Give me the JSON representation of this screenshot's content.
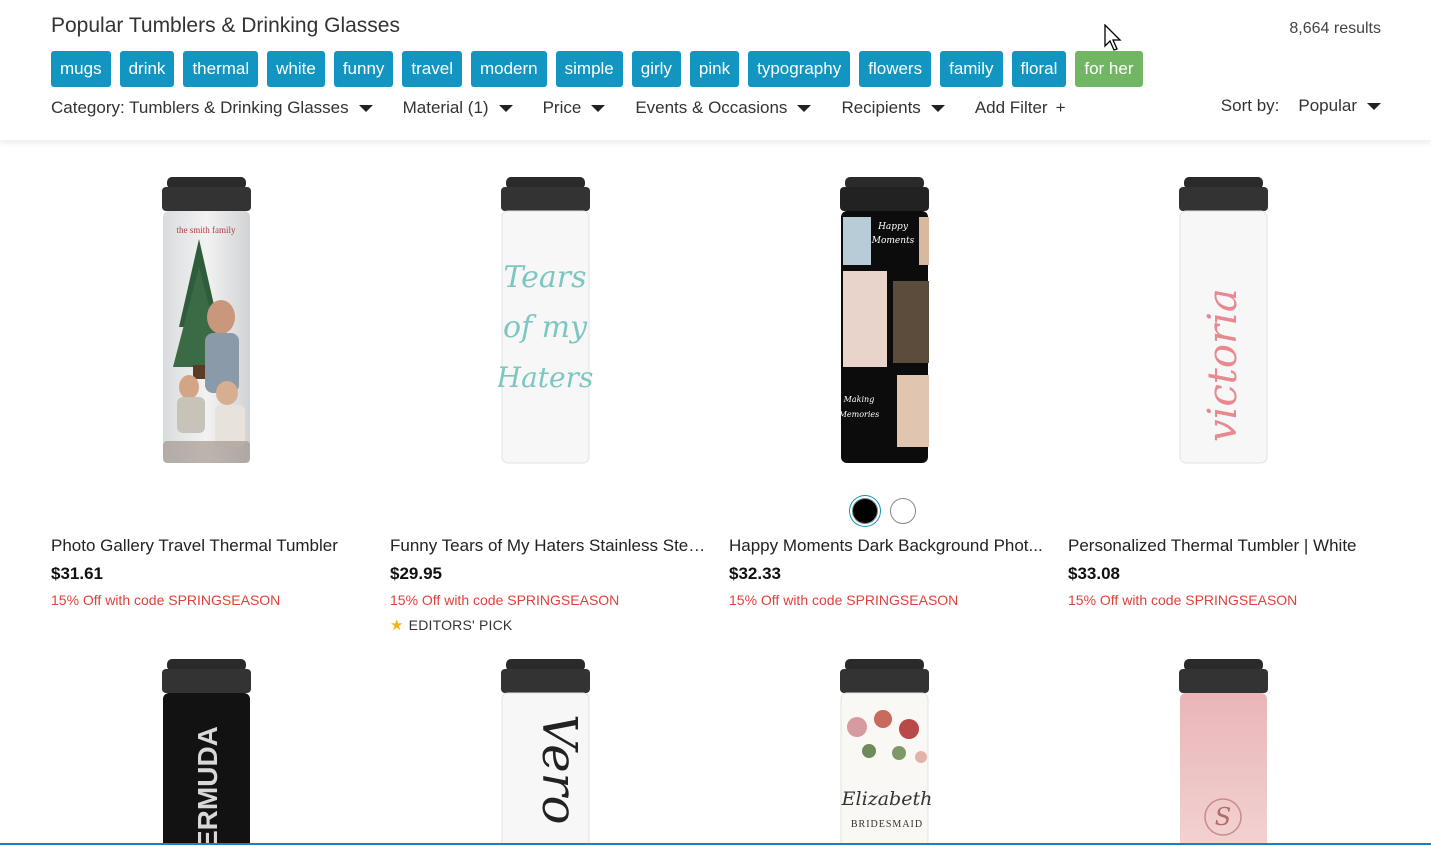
{
  "header": {
    "title": "Popular Tumblers & Drinking Glasses",
    "results": "8,664 results"
  },
  "tags": [
    {
      "label": "mugs",
      "color": "#1296c1"
    },
    {
      "label": "drink",
      "color": "#1296c1"
    },
    {
      "label": "thermal",
      "color": "#1296c1"
    },
    {
      "label": "white",
      "color": "#1296c1"
    },
    {
      "label": "funny",
      "color": "#1296c1"
    },
    {
      "label": "travel",
      "color": "#1296c1"
    },
    {
      "label": "modern",
      "color": "#1296c1"
    },
    {
      "label": "simple",
      "color": "#1296c1"
    },
    {
      "label": "girly",
      "color": "#1296c1"
    },
    {
      "label": "pink",
      "color": "#1296c1"
    },
    {
      "label": "typography",
      "color": "#1296c1"
    },
    {
      "label": "flowers",
      "color": "#1296c1"
    },
    {
      "label": "family",
      "color": "#1296c1"
    },
    {
      "label": "floral",
      "color": "#1296c1"
    },
    {
      "label": "for her",
      "color": "#71b763"
    }
  ],
  "filters": {
    "category": "Category: Tumblers & Drinking Glasses",
    "material": "Material (1)",
    "price": "Price",
    "events": "Events & Occasions",
    "recipients": "Recipients",
    "add_filter": "Add Filter",
    "add_filter_icon": "+"
  },
  "sort": {
    "label": "Sort by:",
    "value": "Popular"
  },
  "products": [
    {
      "name": "Photo Gallery Travel Thermal Tumbler",
      "price": "$31.61",
      "promo": "15% Off with code SPRINGSEASON",
      "design_text": "the smith family"
    },
    {
      "name": "Funny Tears of My Haters Stainless Stee...",
      "price": "$29.95",
      "promo": "15% Off with code SPRINGSEASON",
      "badge": "EDITORS' PICK",
      "design_text": [
        "Tears",
        "of my",
        "Haters"
      ]
    },
    {
      "name": "Happy Moments Dark Background Phot...",
      "price": "$32.33",
      "promo": "15% Off with code SPRINGSEASON",
      "design_text": [
        "Happy",
        "Moments",
        "Making",
        "Memories"
      ],
      "swatches": [
        "black",
        "white"
      ]
    },
    {
      "name": "Personalized Thermal Tumbler | White",
      "price": "$33.08",
      "promo": "15% Off with code SPRINGSEASON",
      "design_text": "victoria"
    }
  ],
  "products_row2": [
    {
      "design_text": "ERMUDA"
    },
    {
      "design_text": "Vero"
    },
    {
      "design_text": [
        "Elizabeth",
        "BRIDESMAID"
      ]
    },
    {
      "design_text": "S"
    }
  ]
}
